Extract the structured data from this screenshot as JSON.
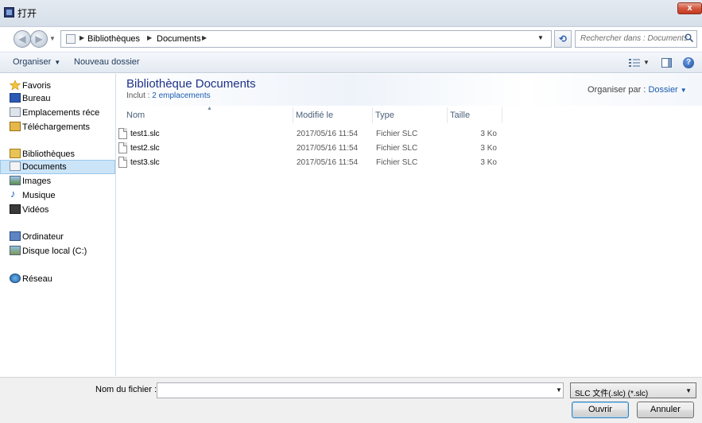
{
  "window": {
    "title": "打开",
    "close_label": "x"
  },
  "address": {
    "crumbs": [
      "Bibliothèques",
      "Documents"
    ],
    "search_placeholder": "Rechercher dans : Documents"
  },
  "toolbar": {
    "organize": "Organiser",
    "new_folder": "Nouveau dossier"
  },
  "sidebar": {
    "favorites": {
      "label": "Favoris",
      "items": [
        "Bureau",
        "Emplacements réce",
        "Téléchargements"
      ]
    },
    "libraries": {
      "label": "Bibliothèques",
      "items": [
        "Documents",
        "Images",
        "Musique",
        "Vidéos"
      ]
    },
    "computer": {
      "label": "Ordinateur",
      "items": [
        "Disque local (C:)"
      ]
    },
    "network": {
      "label": "Réseau"
    }
  },
  "library": {
    "title": "Bibliothèque Documents",
    "includes_prefix": "Inclut : ",
    "includes_link": "2 emplacements",
    "arrange_by_label": "Organiser par :",
    "arrange_by_value": "Dossier"
  },
  "columns": [
    "Nom",
    "Modifié le",
    "Type",
    "Taille"
  ],
  "files": [
    {
      "name": "test1.slc",
      "modified": "2017/05/16 11:54",
      "type": "Fichier SLC",
      "size": "3 Ko"
    },
    {
      "name": "test2.slc",
      "modified": "2017/05/16 11:54",
      "type": "Fichier SLC",
      "size": "3 Ko"
    },
    {
      "name": "test3.slc",
      "modified": "2017/05/16 11:54",
      "type": "Fichier SLC",
      "size": "3 Ko"
    }
  ],
  "bottom": {
    "filename_label": "Nom du fichier :",
    "filename_value": "",
    "filetype_selected": "SLC 文件(.slc) (*.slc)",
    "open_button": "Ouvrir",
    "cancel_button": "Annuler"
  }
}
